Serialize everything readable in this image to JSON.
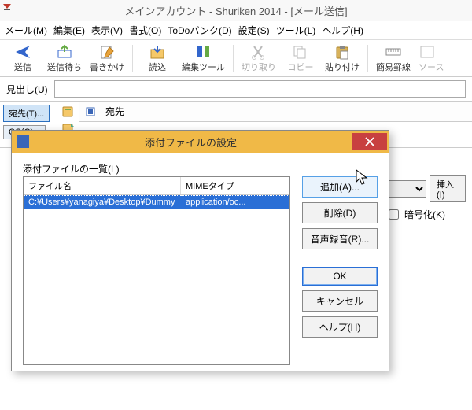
{
  "window_title": "メインアカウント - Shuriken 2014 - [メール送信]",
  "menu": [
    "メール(M)",
    "編集(E)",
    "表示(V)",
    "書式(O)",
    "ToDoバンク(D)",
    "設定(S)",
    "ツール(L)",
    "ヘルプ(H)"
  ],
  "toolbar": [
    {
      "label": "送信",
      "icon": "send-icon",
      "dim": false
    },
    {
      "label": "送信待ち",
      "icon": "outbox-icon",
      "dim": false
    },
    {
      "label": "書きかけ",
      "icon": "draft-icon",
      "dim": false
    },
    {
      "sep": true
    },
    {
      "label": "読込",
      "icon": "load-icon",
      "dim": false
    },
    {
      "label": "編集ツール",
      "icon": "edittools-icon",
      "dim": false
    },
    {
      "sep": true
    },
    {
      "label": "切り取り",
      "icon": "cut-icon",
      "dim": true
    },
    {
      "label": "コピー",
      "icon": "copy-icon",
      "dim": true
    },
    {
      "label": "貼り付け",
      "icon": "paste-icon",
      "dim": false
    },
    {
      "sep": true
    },
    {
      "label": "簡易罫線",
      "icon": "ruler-icon",
      "dim": false
    },
    {
      "label": "ソース",
      "icon": "source-icon",
      "dim": true,
      "cut": true
    }
  ],
  "subject_label": "見出し(U)",
  "subject_value": "",
  "recip": {
    "to_btn": "宛先(T)...",
    "cc_btn": "CC(C)...",
    "header_icon": "recipient-icon",
    "header_label": "宛先"
  },
  "right": {
    "insert_btn": "挿入(I)",
    "encrypt_label": "暗号化(K)"
  },
  "modal": {
    "title": "添付ファイルの設定",
    "list_label": "添付ファイルの一覧(L)",
    "col_file": "ファイル名",
    "col_mime": "MIMEタイプ",
    "rows": [
      {
        "file": "C:¥Users¥yanagiya¥Desktop¥Dummy",
        "mime": "application/oc..."
      }
    ],
    "btn_add": "追加(A)...",
    "btn_del": "削除(D)",
    "btn_rec": "音声録音(R)...",
    "btn_ok": "OK",
    "btn_cancel": "キャンセル",
    "btn_help": "ヘルプ(H)"
  }
}
